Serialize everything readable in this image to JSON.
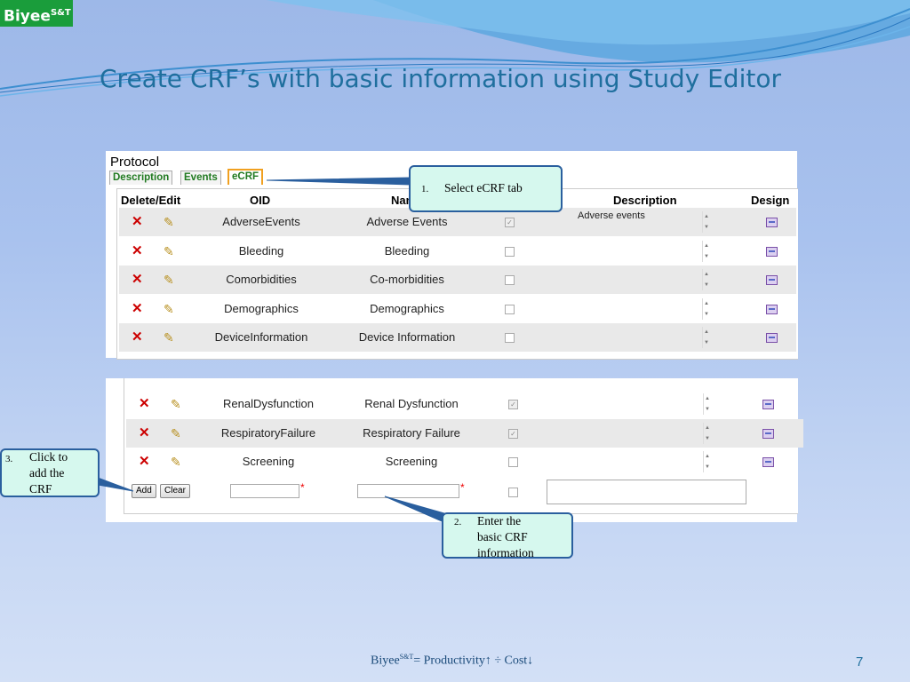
{
  "logo": {
    "text": "Biyee",
    "sup": "S&T"
  },
  "slide_title": "Create CRF’s with basic information using Study Editor",
  "panel": {
    "heading": "Protocol",
    "tabs": [
      {
        "label": "Description"
      },
      {
        "label": "Events"
      },
      {
        "label": "eCRF"
      }
    ],
    "active_tab": "eCRF",
    "columns": {
      "delete_edit": "Delete/Edit",
      "oid": "OID",
      "name": "Nam",
      "description": "Description",
      "design": "Design"
    },
    "rows_top": [
      {
        "oid": "AdverseEvents",
        "name": "Adverse Events",
        "checked": true,
        "description": "Adverse events"
      },
      {
        "oid": "Bleeding",
        "name": "Bleeding",
        "checked": false,
        "description": ""
      },
      {
        "oid": "Comorbidities",
        "name": "Co-morbidities",
        "checked": false,
        "description": ""
      },
      {
        "oid": "Demographics",
        "name": "Demographics",
        "checked": false,
        "description": ""
      },
      {
        "oid": "DeviceInformation",
        "name": "Device Information",
        "checked": false,
        "description": ""
      }
    ],
    "rows_bottom": [
      {
        "oid": "RenalDysfunction",
        "name": "Renal Dysfunction",
        "checked": true
      },
      {
        "oid": "RespiratoryFailure",
        "name": "Respiratory Failure",
        "checked": true
      },
      {
        "oid": "Screening",
        "name": "Screening",
        "checked": false
      }
    ],
    "add_button": "Add",
    "clear_button": "Clear"
  },
  "callouts": {
    "c1": {
      "num": "1.",
      "text": "Select eCRF tab"
    },
    "c2": {
      "num": "2.",
      "lines": [
        "Enter the",
        "basic CRF",
        "information"
      ]
    },
    "c3": {
      "num": "3.",
      "lines": [
        "Click to",
        "add the",
        "CRF"
      ]
    }
  },
  "footer": {
    "brand": "Biyee",
    "sup": "S&T",
    "formula": "= Productivity↑ ÷ Cost↓"
  },
  "page_number": "7",
  "colors": {
    "accent": "#1f6f9e",
    "logo_bg": "#1a9d3b",
    "callout_bg": "#d6f8ee",
    "callout_border": "#2a5f9e"
  }
}
